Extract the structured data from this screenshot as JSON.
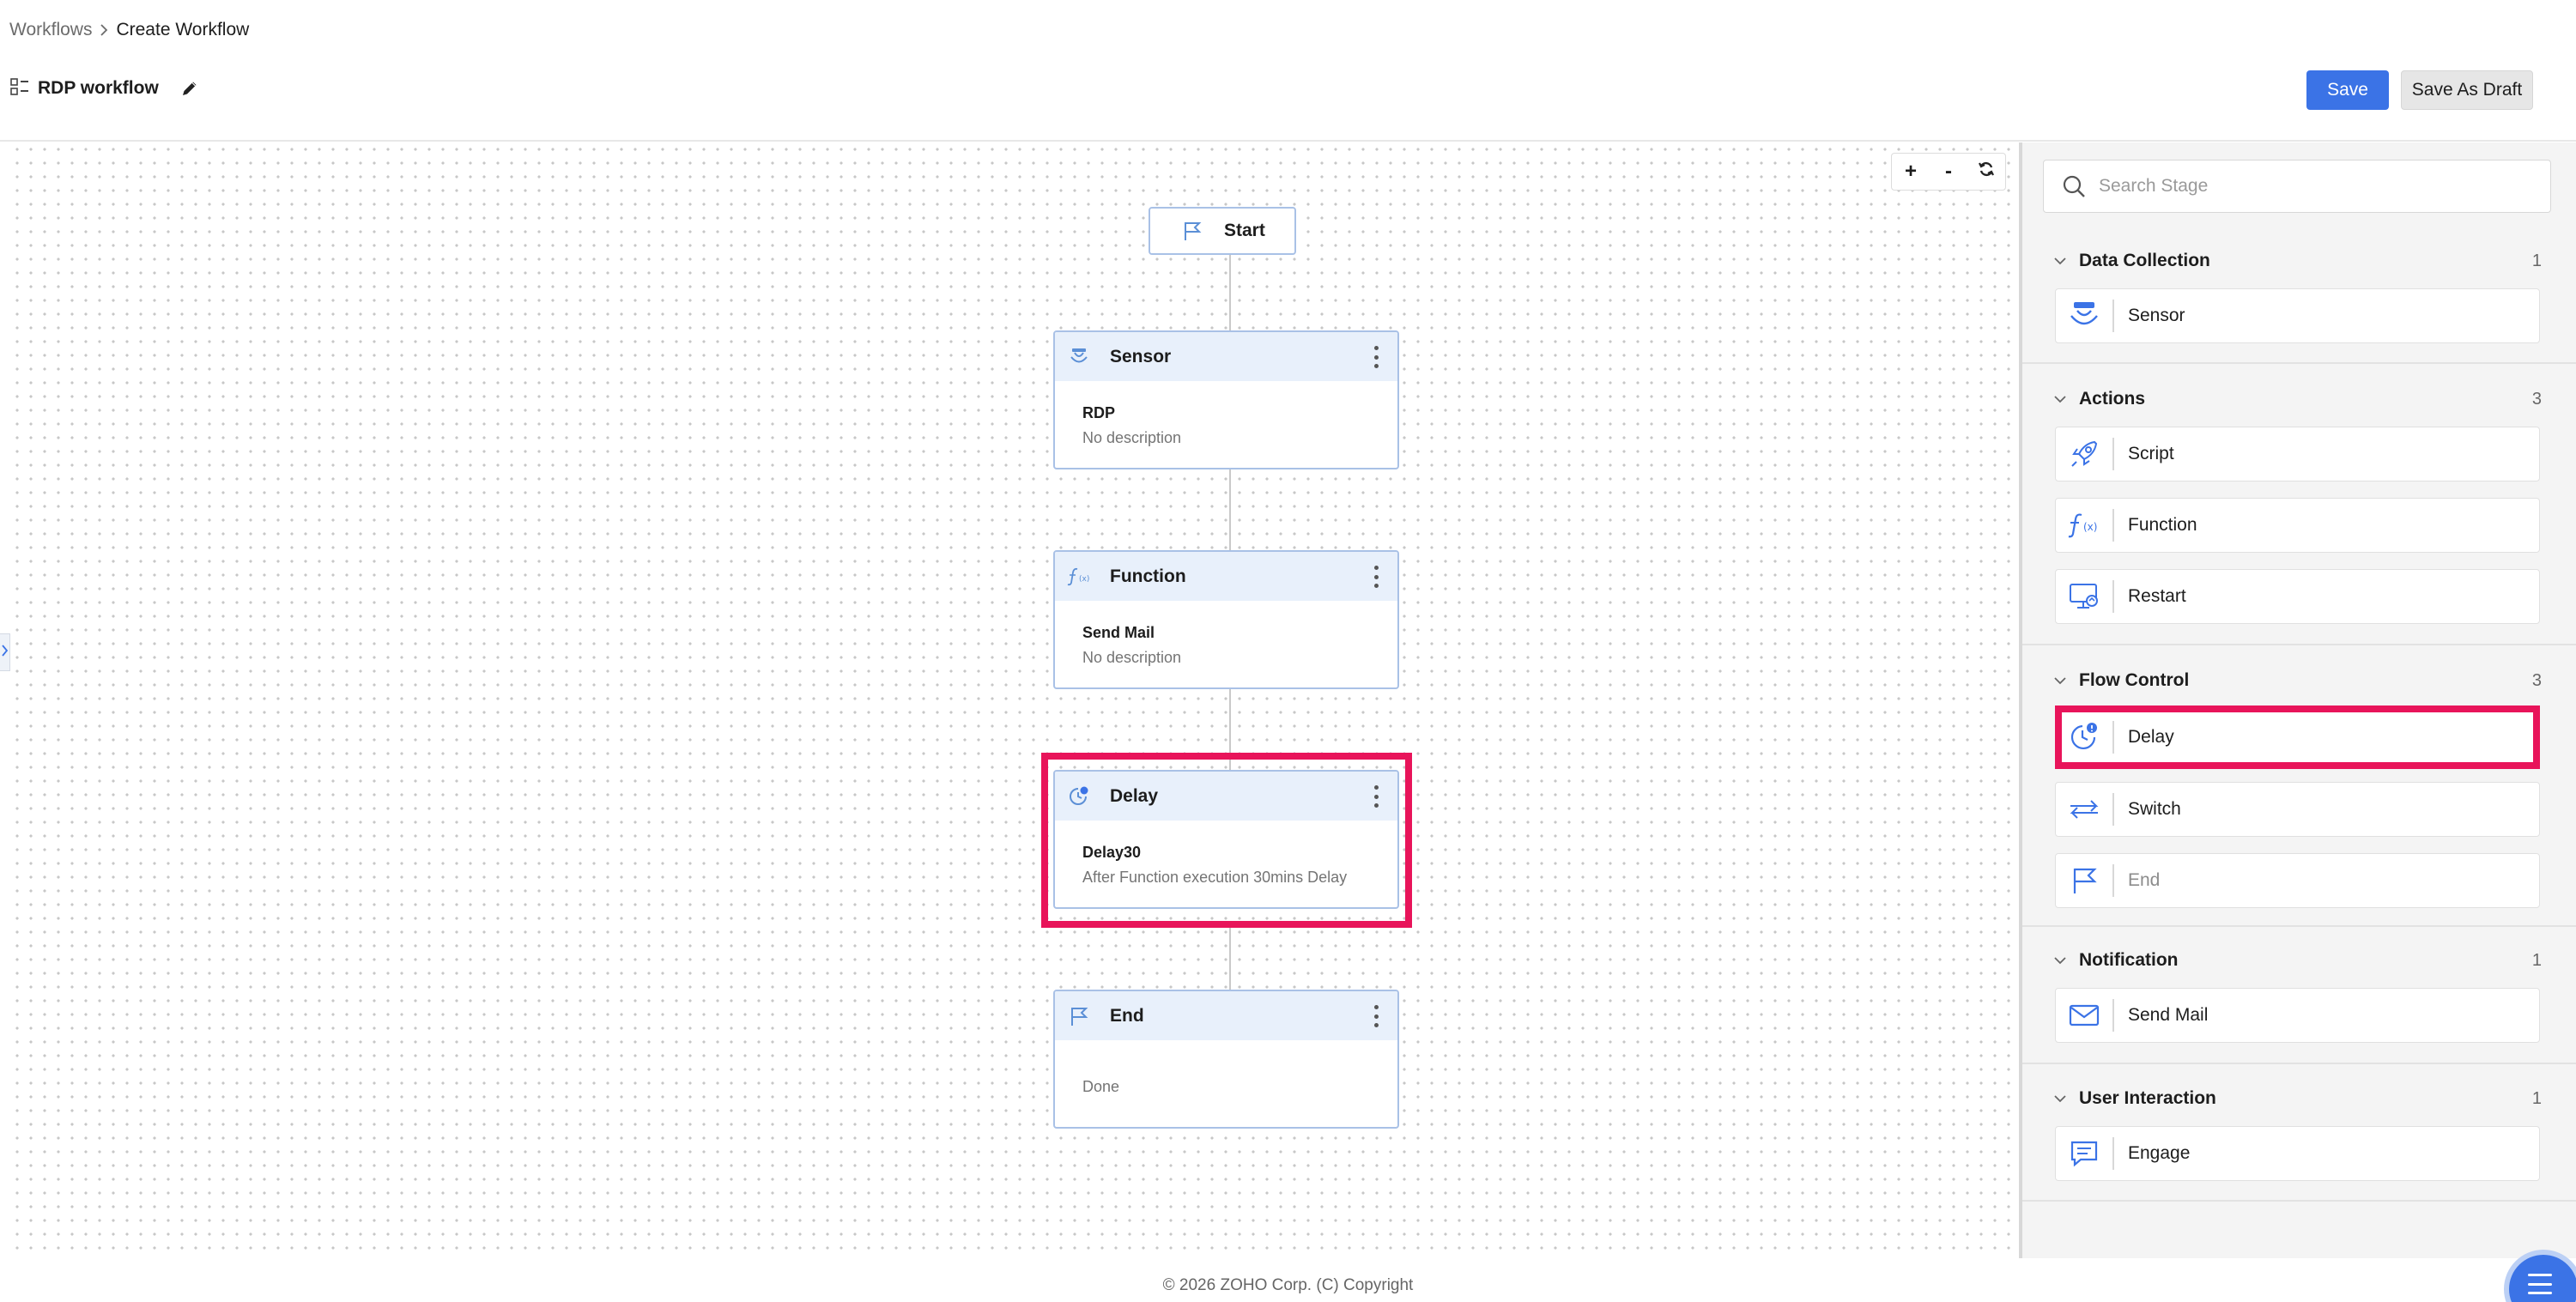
{
  "breadcrumb": {
    "parent": "Workflows",
    "current": "Create Workflow"
  },
  "workflow": {
    "title": "RDP workflow"
  },
  "toolbar": {
    "save_label": "Save",
    "draft_label": "Save As Draft"
  },
  "canvas": {
    "zoom": {
      "in": "+",
      "out": "-"
    },
    "start_label": "Start",
    "nodes": [
      {
        "type": "Sensor",
        "icon": "sensor-icon",
        "name": "RDP",
        "description": "No description"
      },
      {
        "type": "Function",
        "icon": "function-icon",
        "name": "Send Mail",
        "description": "No description"
      },
      {
        "type": "Delay",
        "icon": "delay-icon",
        "name": "Delay30",
        "description": "After Function execution 30mins Delay"
      },
      {
        "type": "End",
        "icon": "flag-icon",
        "name": "",
        "description": "Done"
      }
    ]
  },
  "panel": {
    "search_placeholder": "Search Stage",
    "sections": [
      {
        "title": "Data Collection",
        "count": "1",
        "items": [
          {
            "label": "Sensor",
            "icon": "sensor-icon"
          }
        ]
      },
      {
        "title": "Actions",
        "count": "3",
        "items": [
          {
            "label": "Script",
            "icon": "rocket-icon"
          },
          {
            "label": "Function",
            "icon": "function-icon"
          },
          {
            "label": "Restart",
            "icon": "monitor-restart-icon"
          }
        ]
      },
      {
        "title": "Flow Control",
        "count": "3",
        "items": [
          {
            "label": "Delay",
            "icon": "delay-icon"
          },
          {
            "label": "Switch",
            "icon": "switch-icon"
          },
          {
            "label": "End",
            "icon": "flag-icon"
          }
        ]
      },
      {
        "title": "Notification",
        "count": "1",
        "items": [
          {
            "label": "Send Mail",
            "icon": "mail-icon"
          }
        ]
      },
      {
        "title": "User Interaction",
        "count": "1",
        "items": [
          {
            "label": "Engage",
            "icon": "chat-icon"
          }
        ]
      }
    ]
  },
  "colors": {
    "accent": "#3b73e6",
    "highlight": "#e8145a",
    "node_header": "#e8f0fb",
    "node_border": "#a9c1e6"
  },
  "footer": {
    "copyright": "© 2026 ZOHO Corp. (C) Copyright"
  }
}
